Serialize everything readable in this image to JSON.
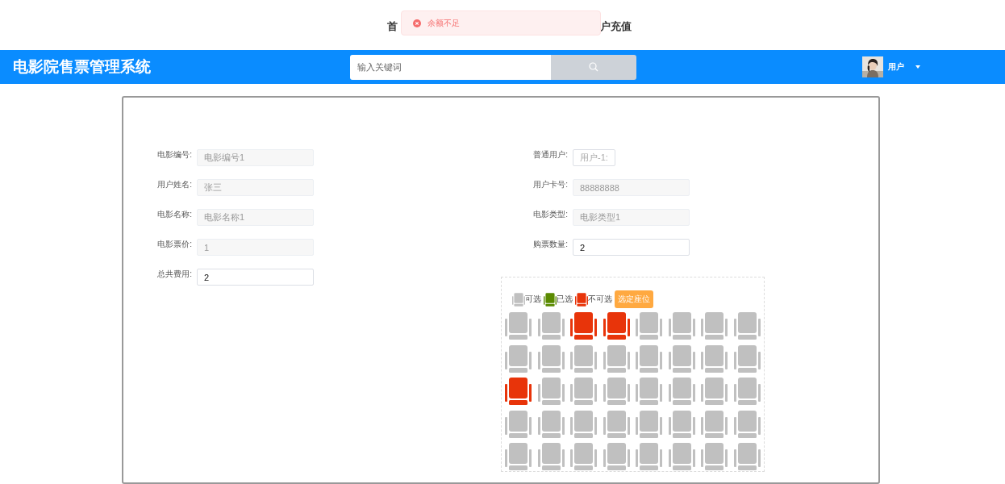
{
  "top_nav": [
    {
      "label": "首"
    },
    {
      "label": "户充值"
    }
  ],
  "toast": {
    "message": "余额不足"
  },
  "header": {
    "title": "电影院售票管理系统",
    "search": {
      "placeholder": "输入关键词"
    },
    "user": {
      "name": "用户"
    }
  },
  "form": {
    "left": [
      {
        "label": "电影编号:",
        "value": "电影编号1",
        "disabled": true,
        "kind": "long"
      },
      {
        "label": "用户姓名:",
        "value": "张三",
        "disabled": true,
        "kind": "long"
      },
      {
        "label": "电影名称:",
        "value": "电影名称1",
        "disabled": true,
        "kind": "long"
      },
      {
        "label": "电影票价:",
        "value": "1",
        "disabled": true,
        "kind": "long"
      },
      {
        "label": "总共费用:",
        "value": "2",
        "disabled": false,
        "kind": "long"
      }
    ],
    "right": [
      {
        "label": "普通用户:",
        "value": "用户-1:",
        "disabled": false,
        "kind": "short"
      },
      {
        "label": "用户卡号:",
        "value": "88888888",
        "disabled": true,
        "kind": "long"
      },
      {
        "label": "电影类型:",
        "value": "电影类型1",
        "disabled": true,
        "kind": "long"
      },
      {
        "label": "购票数量:",
        "value": "2",
        "disabled": false,
        "kind": "long"
      }
    ]
  },
  "seat_map": {
    "legend": [
      {
        "label": "可选",
        "color": "#c0c0c0"
      },
      {
        "label": "已选",
        "color": "#5a8a00"
      },
      {
        "label": "不可选",
        "color": "#e8340a"
      }
    ],
    "button": "选定座位",
    "rows": [
      [
        {
          "disabled": false
        },
        {
          "disabled": false
        },
        {
          "disabled": true
        },
        {
          "disabled": true
        },
        {
          "disabled": false
        },
        {
          "disabled": false
        },
        {
          "disabled": false
        },
        {
          "disabled": false
        }
      ],
      [
        {
          "disabled": false
        },
        {
          "disabled": false
        },
        {
          "disabled": false
        },
        {
          "disabled": false
        },
        {
          "disabled": false
        },
        {
          "disabled": false
        },
        {
          "disabled": false
        },
        {
          "disabled": false
        }
      ],
      [
        {
          "disabled": true
        },
        {
          "disabled": false
        },
        {
          "disabled": false
        },
        {
          "disabled": false
        },
        {
          "disabled": false
        },
        {
          "disabled": false
        },
        {
          "disabled": false
        },
        {
          "disabled": false
        }
      ],
      [
        {
          "disabled": false
        },
        {
          "disabled": false
        },
        {
          "disabled": false
        },
        {
          "disabled": false
        },
        {
          "disabled": false
        },
        {
          "disabled": false
        },
        {
          "disabled": false
        },
        {
          "disabled": false
        }
      ],
      [
        {
          "disabled": false
        },
        {
          "disabled": false
        },
        {
          "disabled": false
        },
        {
          "disabled": false
        },
        {
          "disabled": false
        },
        {
          "disabled": false
        },
        {
          "disabled": false
        },
        {
          "disabled": false
        }
      ]
    ]
  }
}
